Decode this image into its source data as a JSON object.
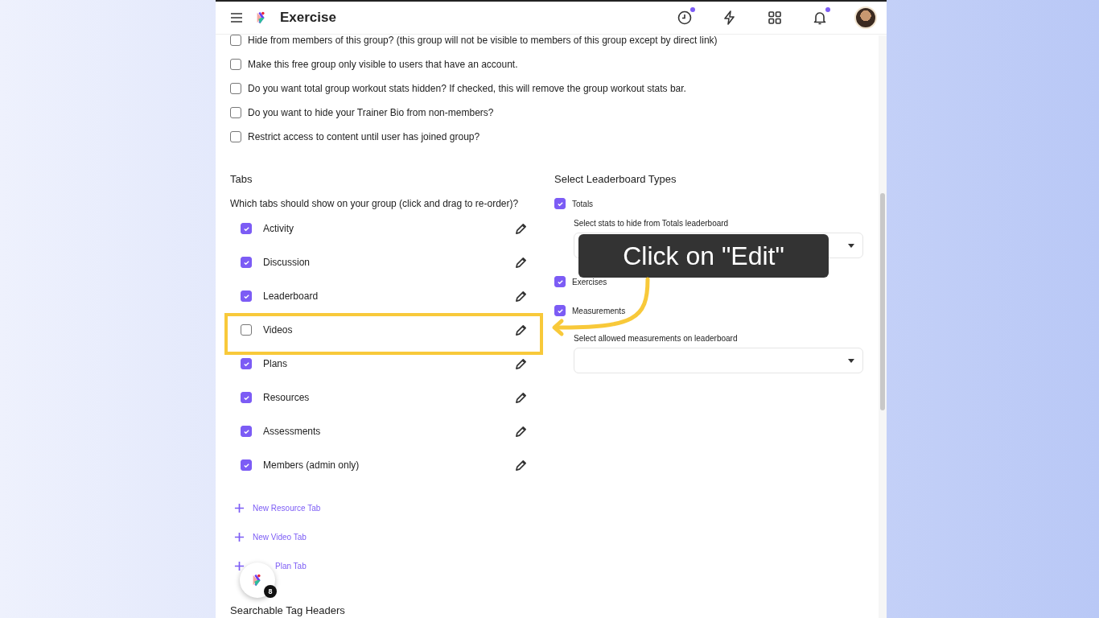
{
  "header": {
    "title": "Exercise",
    "icons": [
      {
        "kind": "clock",
        "dot": true
      },
      {
        "kind": "bolt",
        "dot": false
      },
      {
        "kind": "grid",
        "dot": false
      },
      {
        "kind": "bell",
        "dot": true
      }
    ]
  },
  "settings": [
    {
      "label": "Hide from members of this group? (this group will not be visible to members of this group except by direct link)",
      "checked": false
    },
    {
      "label": "Make this free group only visible to users that have an account.",
      "checked": false
    },
    {
      "label": "Do you want total group workout stats hidden? If checked, this will remove the group workout stats bar.",
      "checked": false
    },
    {
      "label": "Do you want to hide your Trainer Bio from non-members?",
      "checked": false
    },
    {
      "label": "Restrict access to content until user has joined group?",
      "checked": false
    }
  ],
  "tabs": {
    "title": "Tabs",
    "prompt": "Which tabs should show on your group (click and drag to re-order)?",
    "items": [
      {
        "label": "Activity",
        "checked": true
      },
      {
        "label": "Discussion",
        "checked": true
      },
      {
        "label": "Leaderboard",
        "checked": true
      },
      {
        "label": "Videos",
        "checked": false
      },
      {
        "label": "Plans",
        "checked": true
      },
      {
        "label": "Resources",
        "checked": true
      },
      {
        "label": "Assessments",
        "checked": true
      },
      {
        "label": "Members (admin only)",
        "checked": true
      }
    ],
    "links": [
      "New Resource Tab",
      "New Video Tab",
      "Plan Tab"
    ]
  },
  "leaderboard": {
    "title": "Select Leaderboard Types",
    "types": [
      {
        "label": "Totals",
        "checked": true,
        "hint": "Select stats to hide from Totals leaderboard"
      },
      {
        "label": "Exercises",
        "checked": true
      },
      {
        "label": "Measurements",
        "checked": true,
        "hint": "Select allowed measurements on leaderboard"
      }
    ]
  },
  "next_section": {
    "title": "Searchable Tag Headers"
  },
  "tooltip": {
    "text": "Click on \"Edit\""
  },
  "floating_badge": {
    "count": "8"
  }
}
